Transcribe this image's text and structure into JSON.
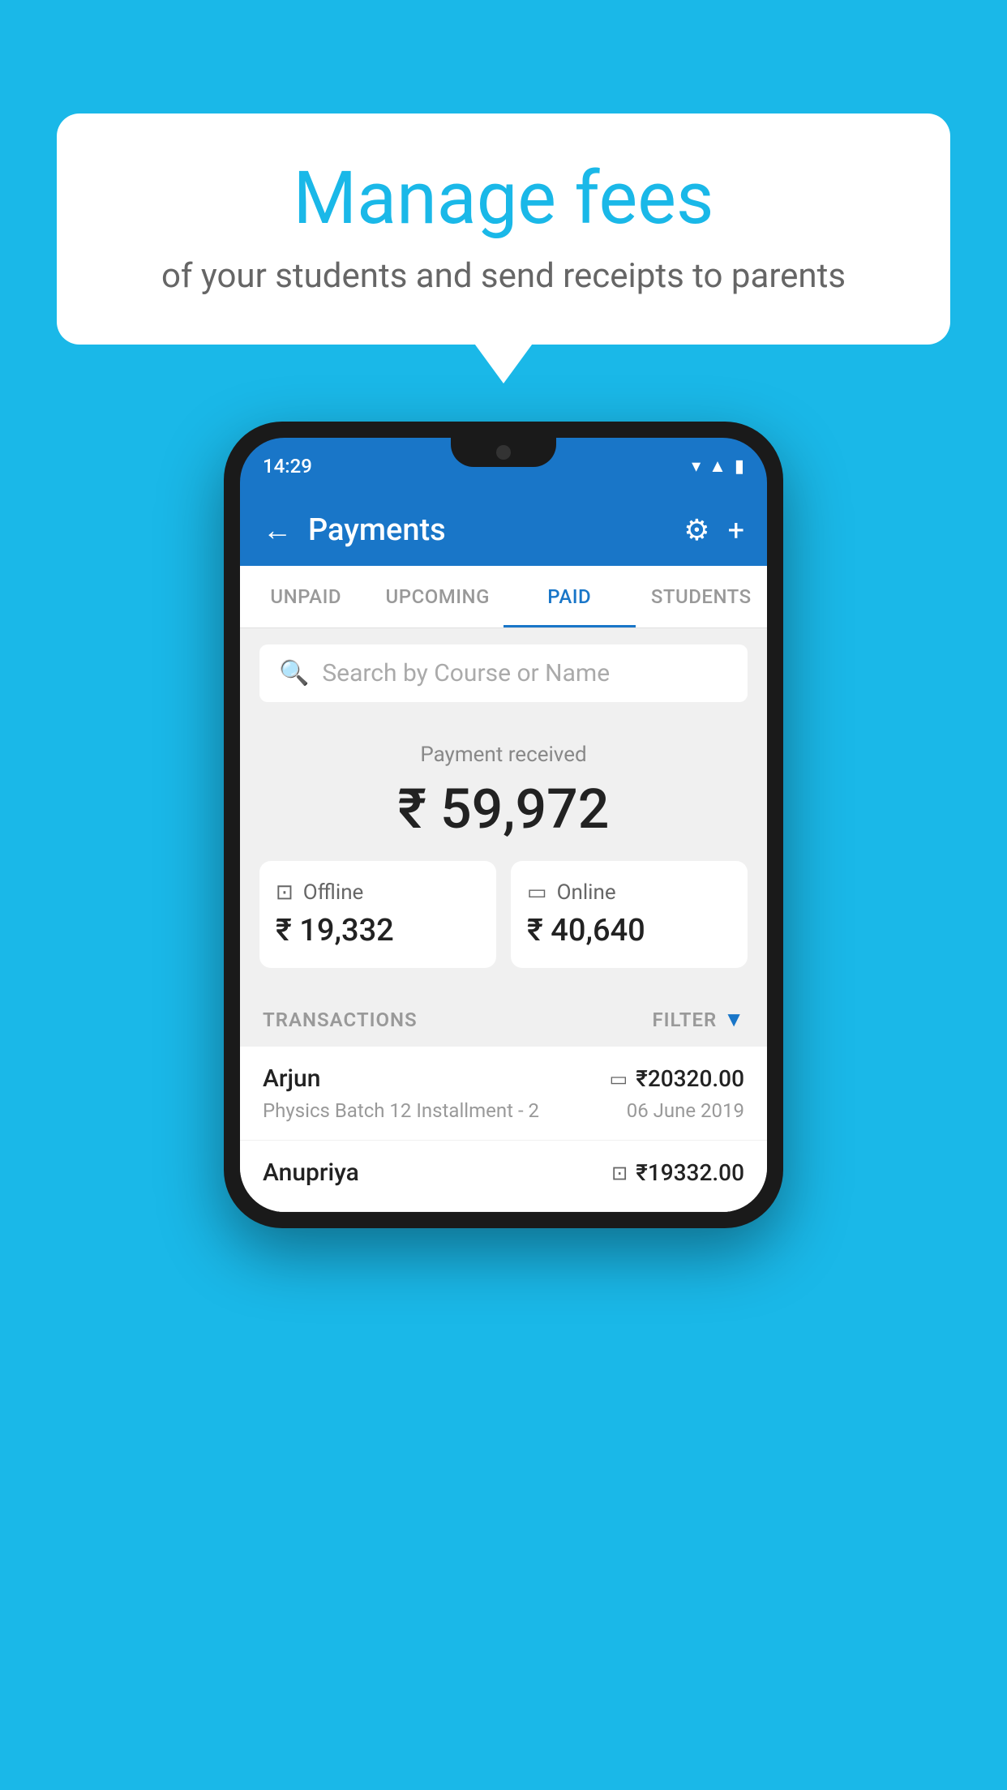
{
  "background_color": "#1ab8e8",
  "speech_bubble": {
    "title": "Manage fees",
    "subtitle": "of your students and send receipts to parents"
  },
  "phone": {
    "status_bar": {
      "time": "14:29"
    },
    "header": {
      "title": "Payments",
      "back_label": "←",
      "gear_label": "⚙",
      "plus_label": "+"
    },
    "tabs": [
      {
        "label": "UNPAID",
        "active": false
      },
      {
        "label": "UPCOMING",
        "active": false
      },
      {
        "label": "PAID",
        "active": true
      },
      {
        "label": "STUDENTS",
        "active": false
      }
    ],
    "search": {
      "placeholder": "Search by Course or Name"
    },
    "payment_summary": {
      "label": "Payment received",
      "total": "₹ 59,972",
      "offline_label": "Offline",
      "offline_amount": "₹ 19,332",
      "online_label": "Online",
      "online_amount": "₹ 40,640"
    },
    "transactions": {
      "header_label": "TRANSACTIONS",
      "filter_label": "FILTER",
      "rows": [
        {
          "name": "Arjun",
          "course": "Physics Batch 12 Installment - 2",
          "amount": "₹20320.00",
          "date": "06 June 2019",
          "payment_type": "online"
        },
        {
          "name": "Anupriya",
          "course": "",
          "amount": "₹19332.00",
          "date": "",
          "payment_type": "offline"
        }
      ]
    }
  }
}
